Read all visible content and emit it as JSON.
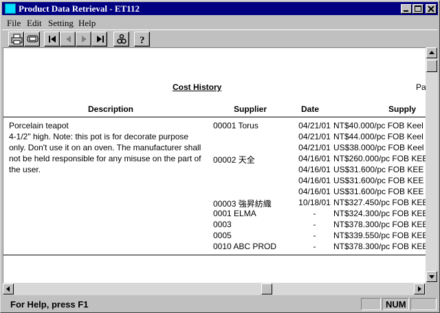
{
  "window": {
    "title": "Product Data Retrieval - ET112"
  },
  "menu": [
    "File",
    "Edit",
    "Setting",
    "Help"
  ],
  "report": {
    "title": "Cost History",
    "page_label": "Pa",
    "columns": {
      "description": "Description",
      "supplier": "Supplier",
      "date": "Date",
      "supply": "Supply"
    },
    "description_lines": [
      "Porcelain teapot",
      "4-1/2\" high. Note: this pot is for decorate purpose",
      "only. Don't use it on an oven. The manufacturer shall",
      "not be held responsible for any misuse on the part of",
      "the user."
    ],
    "rows": [
      {
        "supplier": "00001 Torus",
        "date": "04/21/01",
        "supply": "NT$40.000/pc FOB Keel"
      },
      {
        "supplier": "",
        "date": "04/21/01",
        "supply": "NT$44.000/pc FOB Keel"
      },
      {
        "supplier": "",
        "date": "04/21/01",
        "supply": "US$38.000/pc FOB Keel"
      },
      {
        "supplier": "00002 天全",
        "date": "04/16/01",
        "supply": "NT$260.000/pc FOB KEE"
      },
      {
        "supplier": "",
        "date": "04/16/01",
        "supply": "US$31.600/pc FOB KEE"
      },
      {
        "supplier": "",
        "date": "04/16/01",
        "supply": "US$31.600/pc FOB KEE"
      },
      {
        "supplier": "",
        "date": "04/16/01",
        "supply": "US$31.600/pc FOB KEE"
      },
      {
        "supplier": "00003 強昇紡織",
        "date": "10/18/01",
        "supply": "NT$327.450/pc FOB KEE"
      },
      {
        "supplier": "0001 ELMA",
        "date": "-",
        "supply": "NT$324.300/pc FOB KEE"
      },
      {
        "supplier": "0003",
        "date": "-",
        "supply": "NT$378.300/pc FOB KEE"
      },
      {
        "supplier": "0005",
        "date": "-",
        "supply": "NT$339.550/pc FOB KEE"
      },
      {
        "supplier": "0010 ABC PROD",
        "date": "-",
        "supply": "NT$378.300/pc FOB KEE"
      }
    ]
  },
  "status": {
    "help_text": "For Help, press F1",
    "num": "NUM"
  },
  "toolbar_icons": [
    "print-icon",
    "print-preview-icon",
    "first-record-icon",
    "previous-record-icon",
    "next-record-icon",
    "last-record-icon",
    "find-icon",
    "help-icon"
  ]
}
